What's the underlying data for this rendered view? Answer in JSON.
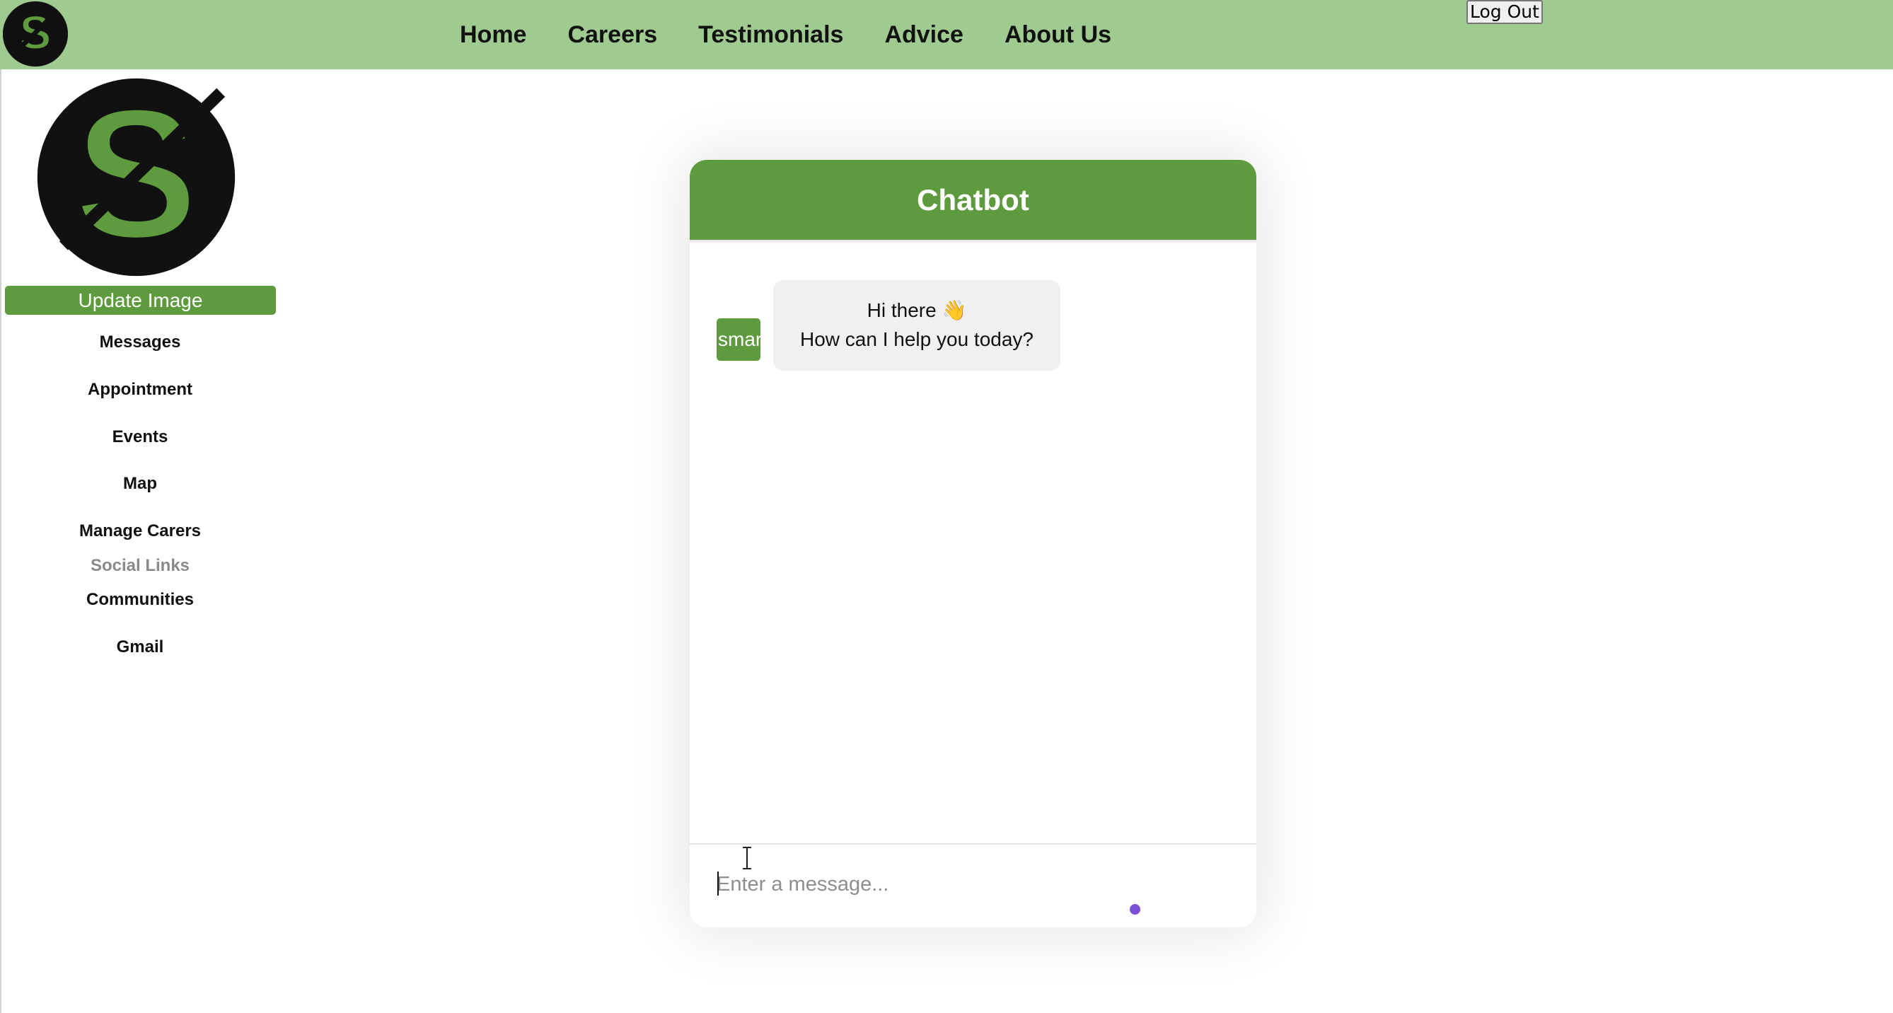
{
  "navbar": {
    "background_color": "#9fcb90",
    "logo_icon": "s-logo-icon",
    "links": [
      {
        "label": "Home"
      },
      {
        "label": "Careers"
      },
      {
        "label": "Testimonials"
      },
      {
        "label": "Advice"
      },
      {
        "label": "About Us"
      }
    ],
    "logout_label": "Log Out"
  },
  "sidebar": {
    "profile_icon": "s-logo-icon",
    "update_image_label": "Update Image",
    "items": [
      {
        "label": "Messages"
      },
      {
        "label": "Appointment"
      },
      {
        "label": "Events"
      },
      {
        "label": "Map"
      },
      {
        "label": "Manage Carers"
      }
    ],
    "social_heading": "Social Links",
    "social_items": [
      {
        "label": "Communities"
      },
      {
        "label": "Gmail"
      }
    ]
  },
  "chat": {
    "title": "Chatbot",
    "accent_color": "#5e9b3e",
    "bot_avatar_text": "smart",
    "messages": [
      {
        "sender": "bot",
        "line1": "Hi there 👋",
        "line2": "How can I help you today?"
      }
    ],
    "input_placeholder": "Enter a message...",
    "input_value": "",
    "send_icon": "send-dot-icon",
    "send_color": "#7b4fd6"
  }
}
